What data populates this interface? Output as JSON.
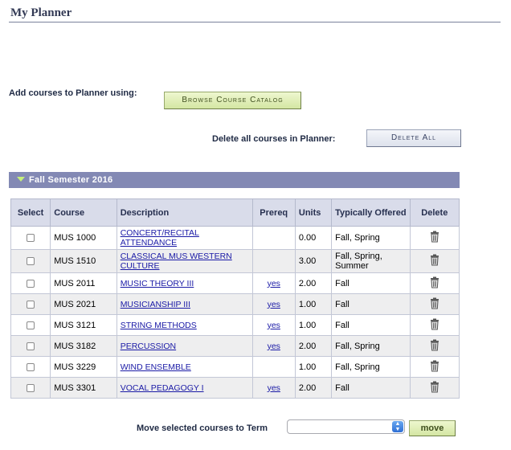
{
  "page": {
    "title": "My Planner"
  },
  "add": {
    "label": "Add courses to Planner using:",
    "browse_button": "Browse Course Catalog"
  },
  "delete_all": {
    "label": "Delete all courses in Planner:",
    "button": "Delete All"
  },
  "semester": {
    "title": "Fall Semester 2016"
  },
  "table": {
    "headers": {
      "select": "Select",
      "course": "Course",
      "description": "Description",
      "prereq": "Prereq",
      "units": "Units",
      "typically": "Typically Offered",
      "delete": "Delete"
    },
    "rows": [
      {
        "course": "MUS 1000",
        "description": "CONCERT/RECITAL ATTENDANCE",
        "prereq": "",
        "units": "0.00",
        "offered": "Fall, Spring"
      },
      {
        "course": "MUS 1510",
        "description": "CLASSICAL MUS WESTERN CULTURE",
        "prereq": "",
        "units": "3.00",
        "offered": "Fall, Spring, Summer"
      },
      {
        "course": "MUS 2011",
        "description": "MUSIC THEORY III",
        "prereq": "yes",
        "units": "2.00",
        "offered": "Fall"
      },
      {
        "course": "MUS 2021",
        "description": "MUSICIANSHIP III",
        "prereq": "yes",
        "units": "1.00",
        "offered": "Fall"
      },
      {
        "course": "MUS 3121",
        "description": "STRING METHODS",
        "prereq": "yes",
        "units": "1.00",
        "offered": "Fall"
      },
      {
        "course": "MUS 3182",
        "description": "PERCUSSION",
        "prereq": "yes",
        "units": "2.00",
        "offered": "Fall, Spring"
      },
      {
        "course": "MUS 3229",
        "description": "WIND ENSEMBLE",
        "prereq": "",
        "units": "1.00",
        "offered": "Fall, Spring"
      },
      {
        "course": "MUS 3301",
        "description": "VOCAL PEDAGOGY I",
        "prereq": "yes",
        "units": "2.00",
        "offered": "Fall"
      }
    ]
  },
  "move": {
    "label": "Move selected courses to Term",
    "selected_term": "",
    "button": "move"
  },
  "icons": {
    "delete": "trash-icon",
    "expand": "triangle-down-icon",
    "select_arrows": "updown-arrows-icon"
  },
  "colors": {
    "semester_bar": "#8389b4",
    "header_bg": "#d9dcea",
    "link": "#1a1aa6",
    "green_button": "#d4e6a3"
  }
}
